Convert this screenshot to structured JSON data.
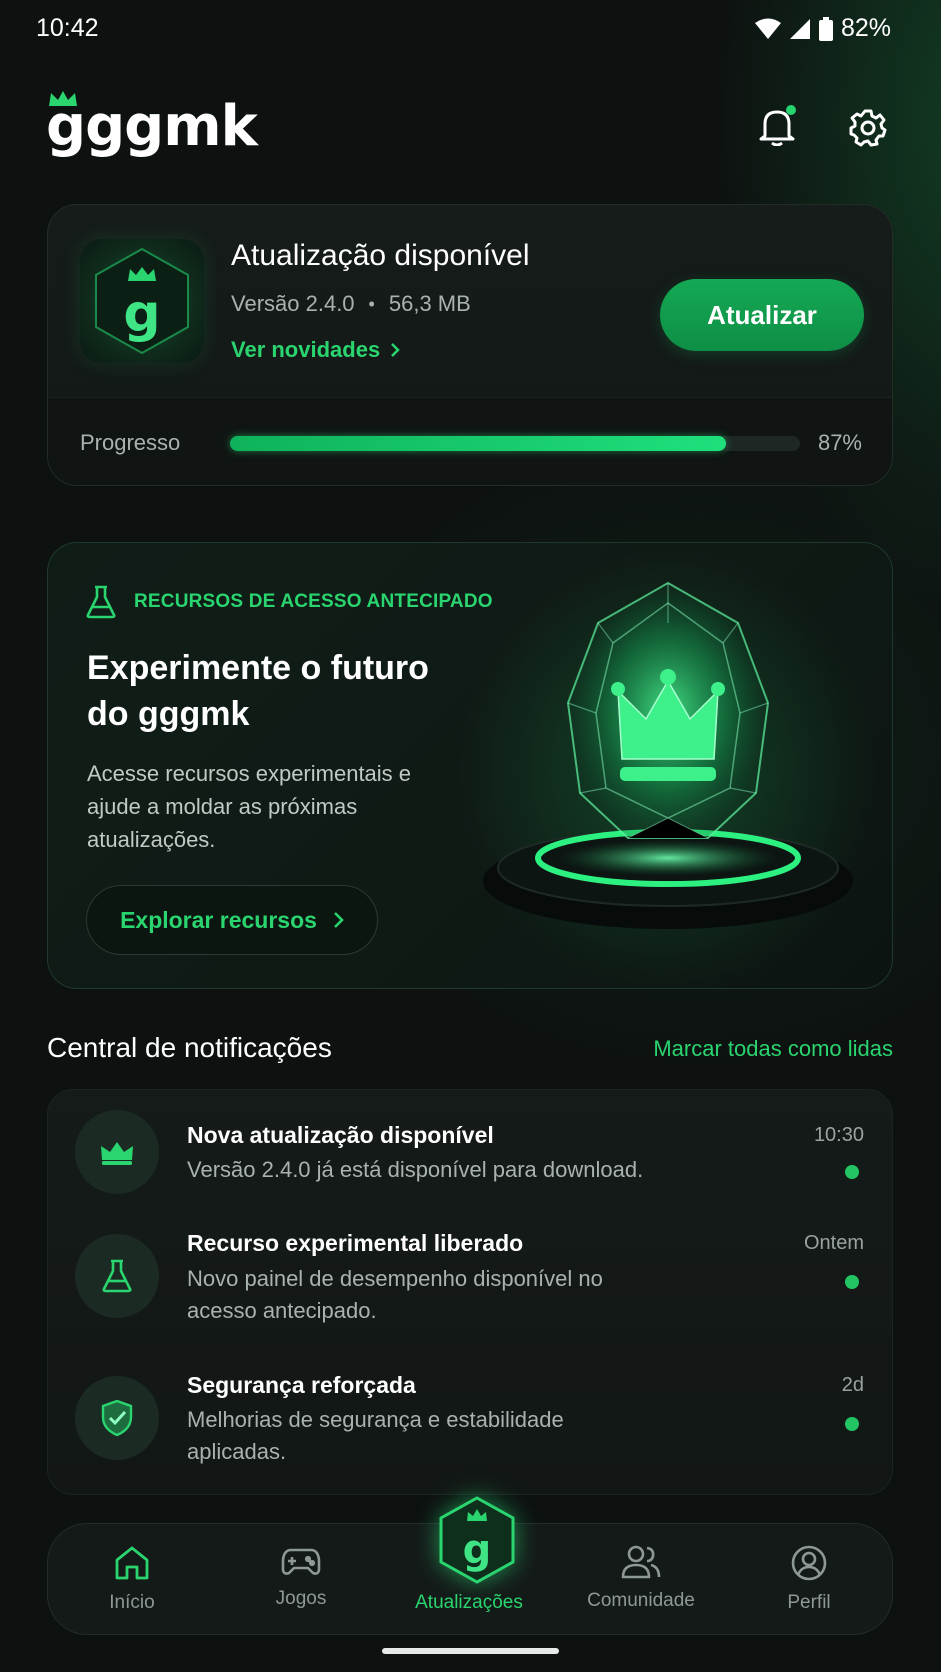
{
  "status_bar": {
    "time": "10:42",
    "battery": "82%"
  },
  "header": {
    "logo": "gggmk"
  },
  "update_card": {
    "title": "Atualização disponível",
    "version": "Versão 2.4.0",
    "size": "56,3 MB",
    "separator": "•",
    "link": "Ver novidades",
    "button": "Atualizar",
    "progress_label": "Progresso",
    "progress_value": 0.87,
    "progress_text": "87%"
  },
  "early_access": {
    "badge": "RECURSOS DE ACESSO ANTECIPADO",
    "title": "Experimente o futuro do gggmk",
    "description": "Acesse recursos experimentais e ajude a moldar as próximas atualizações.",
    "button": "Explorar recursos"
  },
  "notifications": {
    "title": "Central de notificações",
    "mark_all": "Marcar todas como lidas",
    "items": [
      {
        "icon": "crown-icon",
        "title": "Nova atualização disponível",
        "body": "Versão 2.4.0 já está disponível para download.",
        "time": "10:30",
        "unread": true
      },
      {
        "icon": "flask-icon",
        "title": "Recurso experimental liberado",
        "body": "Novo painel de desempenho disponível no acesso antecipado.",
        "time": "Ontem",
        "unread": true
      },
      {
        "icon": "shield-check-icon",
        "title": "Segurança reforçada",
        "body": "Melhorias de segurança e estabilidade aplicadas.",
        "time": "2d",
        "unread": true
      }
    ]
  },
  "bottom_nav": {
    "items": [
      {
        "label": "Início",
        "icon": "home-icon"
      },
      {
        "label": "Jogos",
        "icon": "gamepad-icon"
      },
      {
        "label": "Atualizações",
        "icon": "gggmk-badge-icon",
        "active": true
      },
      {
        "label": "Comunidade",
        "icon": "community-icon"
      },
      {
        "label": "Perfil",
        "icon": "profile-icon"
      }
    ]
  },
  "colors": {
    "accent": "#2ad46f",
    "background": "#0d1110",
    "card": "#151b19"
  }
}
